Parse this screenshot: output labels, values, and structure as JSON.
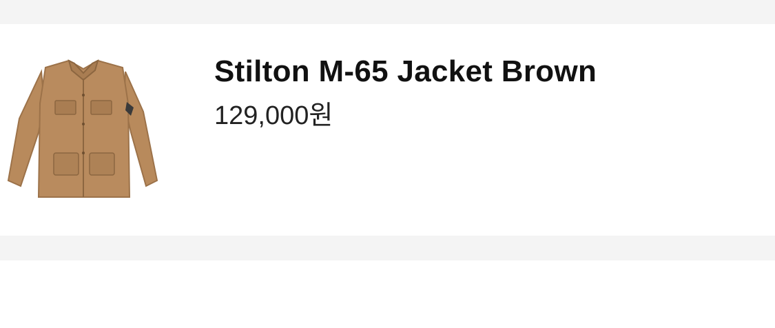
{
  "product": {
    "name": "Stilton M-65 Jacket Brown",
    "price": "129,000원",
    "image_icon": "jacket-image",
    "image_color": "#b88a5c"
  },
  "colors": {
    "band": "#f4f4f4",
    "card": "#ffffff",
    "title_text": "#111111",
    "price_text": "#222222"
  }
}
